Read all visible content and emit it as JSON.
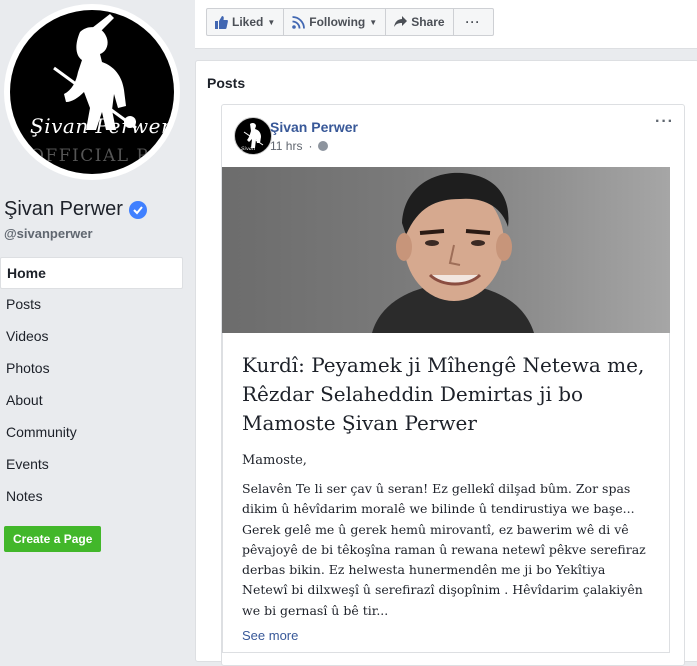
{
  "page": {
    "name": "Şivan Perwer",
    "handle": "@sivanperwer",
    "avatar_signature": "Şivan Perwer",
    "avatar_subtitle": "OFFICIAL PAGE"
  },
  "nav": {
    "items": [
      {
        "label": "Home",
        "active": true
      },
      {
        "label": "Posts"
      },
      {
        "label": "Videos"
      },
      {
        "label": "Photos"
      },
      {
        "label": "About"
      },
      {
        "label": "Community"
      },
      {
        "label": "Events"
      },
      {
        "label": "Notes"
      }
    ],
    "create_page": "Create a Page"
  },
  "actions": {
    "liked": "Liked",
    "following": "Following",
    "share": "Share",
    "more": "···"
  },
  "posts": {
    "heading": "Posts",
    "post": {
      "author": "Şivan Perwer",
      "time": "11 hrs",
      "more": "···",
      "article_title": "Kurdî: Peyamek ji Mîhengê Netewa me, Rêzdar Selaheddin Demirtas ji bo Mamoste Şivan Perwer",
      "greeting": "Mamoste,",
      "body": "Selavên Te li ser çav û seran! Ez gellekî dilşad bûm. Zor spas dikim û hêvîdarim moralê we bilinde û tendirustiya we başe... Gerek gelê me û gerek hemû mirovantî, ez bawerim wê di vê pêvajoyê de bi têkoşîna raman û rewana netewî pêkve serefiraz derbas bikin. Ez helwesta hunermendên me ji bo Yekîtiya Netewî bi dilxweşî û serefirazî dişopînim . Hêvîdarim çalakiyên we bi gernasî û bê tir...",
      "see_more": "See more"
    }
  },
  "colors": {
    "link": "#385898",
    "verified": "#4080ff",
    "create_button": "#42b72a",
    "background": "#e9ebee"
  }
}
